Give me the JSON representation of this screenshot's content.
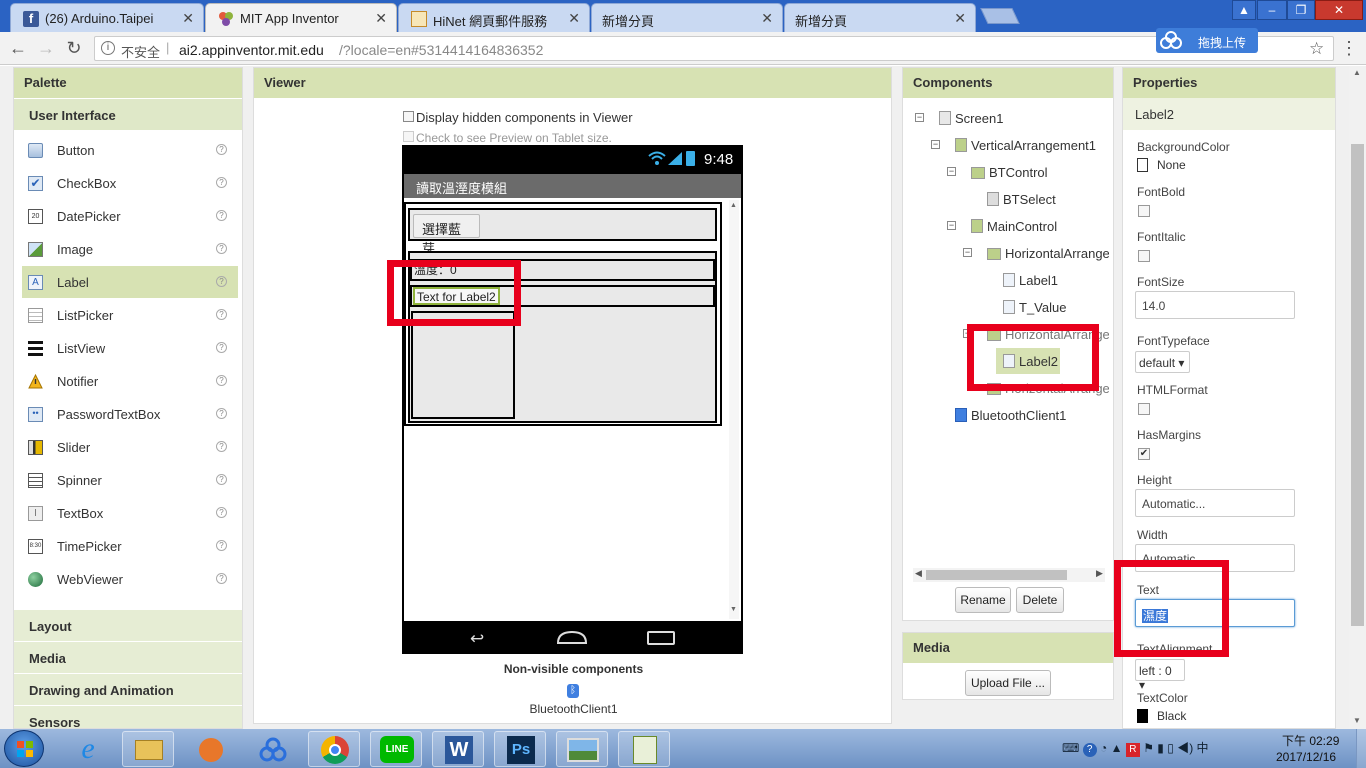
{
  "browser": {
    "tabs": [
      {
        "label": "(26) Arduino.Taipei",
        "active": false
      },
      {
        "label": "MIT App Inventor",
        "active": true
      },
      {
        "label": "HiNet 網頁郵件服務",
        "active": false
      },
      {
        "label": "新增分頁",
        "active": false
      },
      {
        "label": "新增分頁",
        "active": false
      }
    ],
    "insecure_label": "不安全",
    "url_host": "ai2.appinventor.mit.edu",
    "url_rest": "/?locale=en#5314414164836352",
    "upload_label": "拖拽上传"
  },
  "palette": {
    "title": "Palette",
    "category_open": "User Interface",
    "items": [
      {
        "label": "Button",
        "icon": "button-icon"
      },
      {
        "label": "CheckBox",
        "icon": "checkbox-icon"
      },
      {
        "label": "DatePicker",
        "icon": "datepicker-icon"
      },
      {
        "label": "Image",
        "icon": "image-icon"
      },
      {
        "label": "Label",
        "icon": "label-icon"
      },
      {
        "label": "ListPicker",
        "icon": "listpicker-icon"
      },
      {
        "label": "ListView",
        "icon": "listview-icon"
      },
      {
        "label": "Notifier",
        "icon": "notifier-icon"
      },
      {
        "label": "PasswordTextBox",
        "icon": "passwordtextbox-icon"
      },
      {
        "label": "Slider",
        "icon": "slider-icon"
      },
      {
        "label": "Spinner",
        "icon": "spinner-icon"
      },
      {
        "label": "TextBox",
        "icon": "textbox-icon"
      },
      {
        "label": "TimePicker",
        "icon": "timepicker-icon"
      },
      {
        "label": "WebViewer",
        "icon": "webviewer-icon"
      }
    ],
    "selected": "Label",
    "help_glyph": "?",
    "categories": [
      "Layout",
      "Media",
      "Drawing and Animation",
      "Sensors"
    ]
  },
  "viewer": {
    "title": "Viewer",
    "hidden_components_label": "Display hidden components in Viewer",
    "tablet_preview_label": "Check to see Preview on Tablet size.",
    "phone": {
      "time": "9:48",
      "app_title": "讀取溫溼度模組",
      "bt_button": "選擇藍芽",
      "label1_partial": "溫度：0",
      "label2": "Text for Label2"
    },
    "nonvisible_title": "Non-visible components",
    "nonvisible_items": [
      "BluetoothClient1"
    ]
  },
  "components": {
    "title": "Components",
    "tree": [
      {
        "label": "Screen1"
      },
      {
        "label": "VerticalArrangement1"
      },
      {
        "label": "BTControl"
      },
      {
        "label": "BTSelect"
      },
      {
        "label": "MainControl"
      },
      {
        "label": "HorizontalArrangen"
      },
      {
        "label": "Label1"
      },
      {
        "label": "T_Value"
      },
      {
        "label": "HorizontalArrangen"
      },
      {
        "label": "Label2"
      },
      {
        "label": "HorizontalArrangen"
      },
      {
        "label": "BluetoothClient1"
      }
    ],
    "rename_label": "Rename",
    "delete_label": "Delete"
  },
  "media": {
    "title": "Media",
    "upload_label": "Upload File ..."
  },
  "properties": {
    "title": "Properties",
    "component": "Label2",
    "background_color_label": "BackgroundColor",
    "background_color_value": "None",
    "fontbold_label": "FontBold",
    "fontitalic_label": "FontItalic",
    "fontsize_label": "FontSize",
    "fontsize_value": "14.0",
    "fonttypeface_label": "FontTypeface",
    "fonttypeface_value": "default ▾",
    "htmlformat_label": "HTMLFormat",
    "hasmargins_label": "HasMargins",
    "height_label": "Height",
    "height_value": "Automatic...",
    "width_label": "Width",
    "width_value": "Automatic...",
    "text_label": "Text",
    "text_value": "濕度",
    "textalignment_label": "TextAlignment",
    "textalignment_value": "left : 0 ▾",
    "textcolor_label": "TextColor",
    "textcolor_value": "Black"
  },
  "taskbar": {
    "time": "下午 02:29",
    "date": "2017/12/16"
  },
  "colors": {
    "panel_header": "#d7e2b3",
    "highlight": "#e8001c",
    "accent_green": "#8fb33b"
  }
}
